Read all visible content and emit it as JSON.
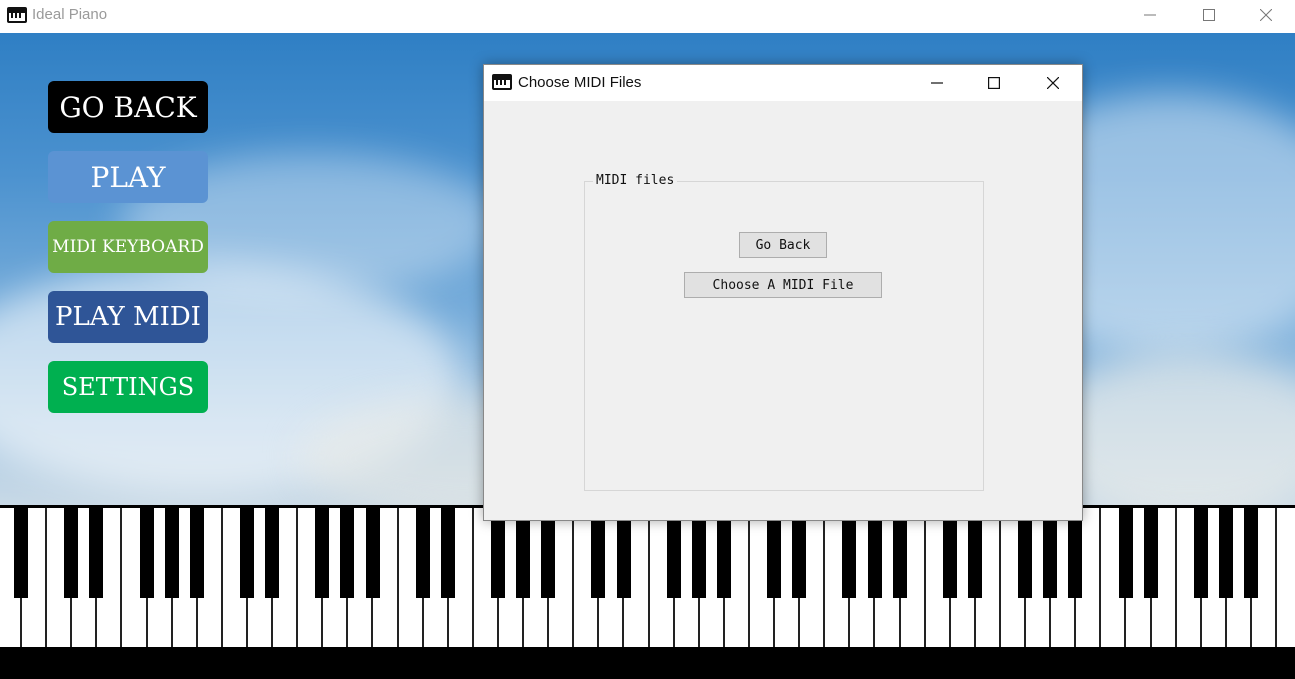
{
  "window": {
    "title": "Ideal Piano",
    "controls": {
      "minimize": "minimize-icon",
      "maximize": "maximize-icon",
      "close": "close-icon"
    }
  },
  "menu": {
    "buttons": [
      {
        "label": "GO BACK",
        "color": "#000000"
      },
      {
        "label": "PLAY",
        "color": "#5b93d3"
      },
      {
        "label": "MIDI KEYBOARD",
        "color": "#6fac46"
      },
      {
        "label": "PLAY MIDI",
        "color": "#2f5597"
      },
      {
        "label": "SETTINGS",
        "color": "#00b050"
      }
    ]
  },
  "dialog": {
    "title": "Choose MIDI Files",
    "group_label": "MIDI files",
    "go_back_label": "Go Back",
    "choose_label": "Choose A MIDI File"
  },
  "colors": {
    "sky_top": "#2f7fc4",
    "sky_bottom": "#c8d9e6",
    "dialog_bg": "#f0f0f0"
  }
}
